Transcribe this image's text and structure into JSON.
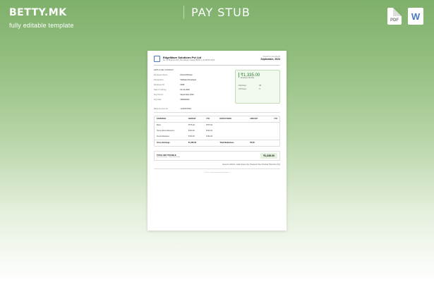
{
  "header": {
    "brand": "BETTY.MK",
    "tagline": "fully editable template",
    "title": "PAY STUB",
    "pdf_label": "PDF",
    "word_label": "W"
  },
  "payslip": {
    "company": "EdgeWave Solutions Pvt Ltd",
    "address": "No. 12, Business Park, Ahmedabad, Gujarat 380015 | +91 98765 43210",
    "month_label": "Payslip For the Month",
    "month": "September, 2024",
    "summary_title": "EMPLOYEE SUMMARY",
    "employee": [
      {
        "k": "Employee Name",
        "v": ": Ahmed Rizwan"
      },
      {
        "k": "Designation",
        "v": ": Software Developer"
      },
      {
        "k": "Employee ID",
        "v": ": 0036"
      },
      {
        "k": "Date of Joining",
        "v": ": 01-01-2020"
      },
      {
        "k": "Pay Period",
        "v": ": September 2024"
      },
      {
        "k": "Pay Date",
        "v": ": 30/09/2024"
      }
    ],
    "net_amount": "₹1,335.00",
    "net_label": "Employee Net Pay",
    "net_rows": [
      {
        "k": "Paid Days",
        "v": ": 30"
      },
      {
        "k": "LOP Days",
        "v": ": 0"
      }
    ],
    "pan_label": "Bank Account No",
    "pan_value": ": 12345678901",
    "table_head": [
      "EARNINGS",
      "AMOUNT",
      "YTD",
      "DEDUCTIONS",
      "AMOUNT",
      "YTD"
    ],
    "table_rows": [
      [
        "Basic",
        "₹975.00",
        "₹975.00",
        "",
        "",
        ""
      ],
      [
        "House Rent Allowance",
        "₹200.00",
        "₹200.00",
        "",
        "",
        ""
      ],
      [
        "Fixed Allowance",
        "₹160.00",
        "₹160.00",
        "",
        "",
        ""
      ]
    ],
    "table_total": [
      "Gross Earnings",
      "₹1,335.00",
      "",
      "Total Deductions",
      "₹0.00",
      ""
    ],
    "total_label": "TOTAL NET PAYABLE",
    "total_sub": "Gross Earnings - Total Deductions",
    "total_amount": "₹1,335.00",
    "amount_words": "Amount In Words : Indian Rupee One Thousand Three Hundred Thirty-Five Only",
    "footer": "-- This is a system-generated document. --"
  }
}
